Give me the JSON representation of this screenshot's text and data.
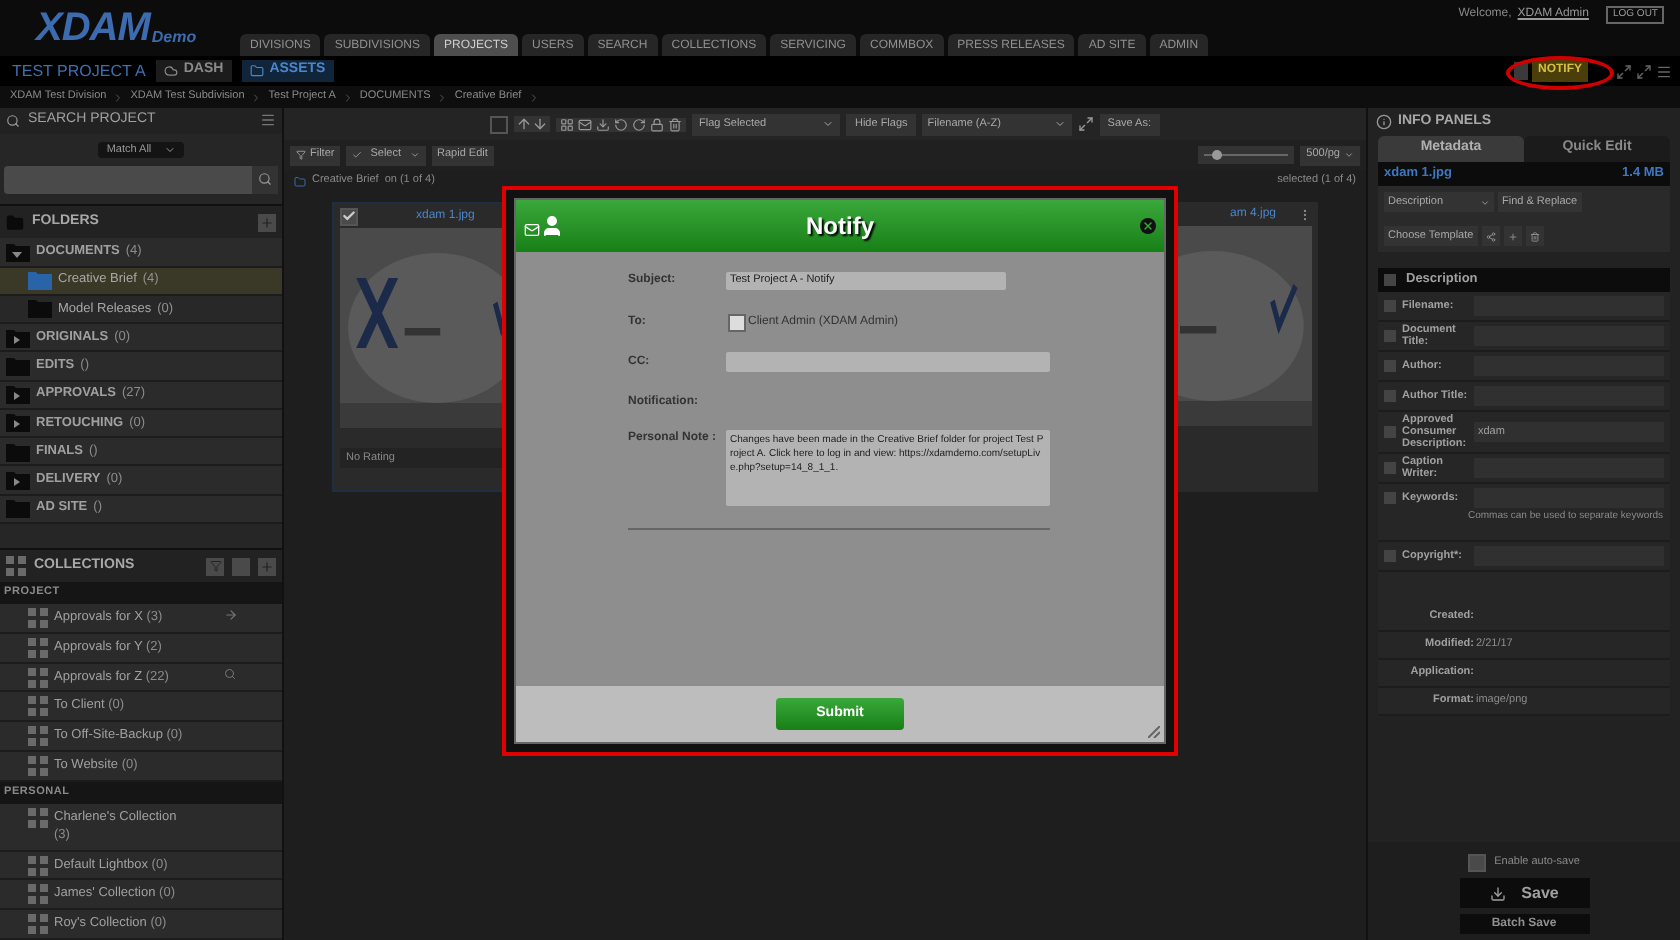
{
  "header": {
    "logo": "XDAM",
    "logo_sub": "Demo",
    "welcome": "Welcome,",
    "user": "XDAM Admin",
    "logout": "LOG OUT"
  },
  "tabs": [
    {
      "label": "DIVISIONS",
      "selected": false
    },
    {
      "label": "SUBDIVISIONS",
      "selected": false
    },
    {
      "label": "PROJECTS",
      "selected": true
    },
    {
      "label": "USERS",
      "selected": false
    },
    {
      "label": "SEARCH",
      "selected": false
    },
    {
      "label": "COLLECTIONS",
      "selected": false
    },
    {
      "label": "SERVICING",
      "selected": false
    },
    {
      "label": "COMMBOX",
      "selected": false
    },
    {
      "label": "PRESS RELEASES",
      "selected": false
    },
    {
      "label": "AD SITE",
      "selected": false
    },
    {
      "label": "ADMIN",
      "selected": false
    }
  ],
  "project_bar": {
    "title": "TEST PROJECT A",
    "buttons": [
      {
        "label": "DASH",
        "selected": false
      },
      {
        "label": "ASSETS",
        "selected": true
      }
    ],
    "notify": "NOTIFY"
  },
  "breadcrumb": [
    "XDAM Test Division",
    "XDAM Test Subdivision",
    "Test Project A",
    "DOCUMENTS",
    "Creative Brief"
  ],
  "sidebar": {
    "search_title": "SEARCH PROJECT",
    "match": "Match All",
    "folders_title": "FOLDERS",
    "folders": [
      {
        "name": "DOCUMENTS",
        "count": "(4)",
        "kind": "branch",
        "expanded": true,
        "children": [
          {
            "name": "Creative Brief",
            "count": "(4)",
            "selected": true
          },
          {
            "name": "Model Releases",
            "count": "(0)",
            "selected": false
          }
        ]
      },
      {
        "name": "ORIGINALS",
        "count": "(0)",
        "kind": "branch",
        "expanded": false
      },
      {
        "name": "EDITS",
        "count": "()",
        "kind": "leaf"
      },
      {
        "name": "APPROVALS",
        "count": "(27)",
        "kind": "branch",
        "expanded": false
      },
      {
        "name": "RETOUCHING",
        "count": "(0)",
        "kind": "branch",
        "expanded": false
      },
      {
        "name": "FINALS",
        "count": "()",
        "kind": "leaf"
      },
      {
        "name": "DELIVERY",
        "count": "(0)",
        "kind": "branch",
        "expanded": false
      },
      {
        "name": "AD SITE",
        "count": "()",
        "kind": "leaf"
      }
    ],
    "collections_title": "COLLECTIONS",
    "collection_groups": [
      {
        "label": "PROJECT",
        "items": [
          {
            "name": "Approvals for X",
            "count": "(3)",
            "kind": "share"
          },
          {
            "name": "Approvals for Y",
            "count": "(2)"
          },
          {
            "name": "Approvals for Z",
            "count": "(22)",
            "kind": "search"
          },
          {
            "name": "To Client",
            "count": "(0)"
          },
          {
            "name": "To Off-Site-Backup",
            "count": "(0)"
          },
          {
            "name": "To Website",
            "count": "(0)"
          }
        ]
      },
      {
        "label": "PERSONAL",
        "items": [
          {
            "name": "Charlene's Collection",
            "count": "(3)"
          },
          {
            "name": "Default Lightbox",
            "count": "(0)"
          },
          {
            "name": "James' Collection",
            "count": "(0)"
          },
          {
            "name": "Roy's Collection",
            "count": "(0)"
          }
        ]
      }
    ]
  },
  "toolbar": {
    "flag": "Flag Selected",
    "hide_flags": "Hide Flags",
    "sort": "Filename (A-Z)",
    "save_as": "Save As:",
    "filter": "Filter",
    "select": "Select",
    "rapid_edit": "Rapid Edit",
    "per_page": "500/pg",
    "zoom": {
      "level": 0.1
    }
  },
  "path": {
    "folder": "Creative Brief",
    "shown": "on (1 of 4)",
    "selected": "selected (1 of 4)"
  },
  "cards": [
    {
      "title": "xdam 1.jpg",
      "checked": true,
      "rating": "No Rating"
    },
    {
      "title": "am 4.jpg"
    }
  ],
  "modal": {
    "title": "Notify",
    "subject_label": "Subject:",
    "subject": "Test Project A - Notify",
    "to_label": "To:",
    "recipients": [
      {
        "label": "Client Admin (XDAM Admin)",
        "checked": false
      }
    ],
    "cc_label": "CC:",
    "notification_label": "Notification:",
    "note_label": "Personal Note :",
    "note": "Changes have been made in the Creative Brief folder for project Test Project A. Click here to log in and view: https://xdamdemo.com/setupLive.php?setup=14_8_1_1.",
    "submit": "Submit"
  },
  "info": {
    "title": "INFO PANELS",
    "tabs": [
      {
        "label": "Metadata",
        "selected": true
      },
      {
        "label": "Quick Edit",
        "selected": false
      }
    ],
    "file": "xdam 1.jpg",
    "size": "1.4 MB",
    "schema": "Description",
    "find_replace": "Find & Replace",
    "template": "Choose Template",
    "section": "Description",
    "section_checked": false,
    "fields": [
      {
        "label": "Filename:",
        "checked": false
      },
      {
        "label": "Document Title:",
        "checked": false
      },
      {
        "label": "Author:",
        "checked": false
      },
      {
        "label": "Author Title:",
        "checked": false
      },
      {
        "label": "Approved Consumer Description:",
        "value": "xdam",
        "checked": false
      },
      {
        "label": "Caption Writer:",
        "checked": false
      },
      {
        "label": "Keywords:",
        "hint": "Commas can be used to separate keywords",
        "checked": false
      },
      {
        "label": "Copyright*:",
        "checked": false
      }
    ],
    "details": [
      {
        "label": "Created:"
      },
      {
        "label": "Modified:",
        "value": "2/21/17"
      },
      {
        "label": "Application:"
      },
      {
        "label": "Format:",
        "value": "image/png"
      }
    ],
    "autosave": {
      "label": "Enable auto-save",
      "checked": false
    },
    "save": "Save",
    "batch_save": "Batch Save"
  }
}
